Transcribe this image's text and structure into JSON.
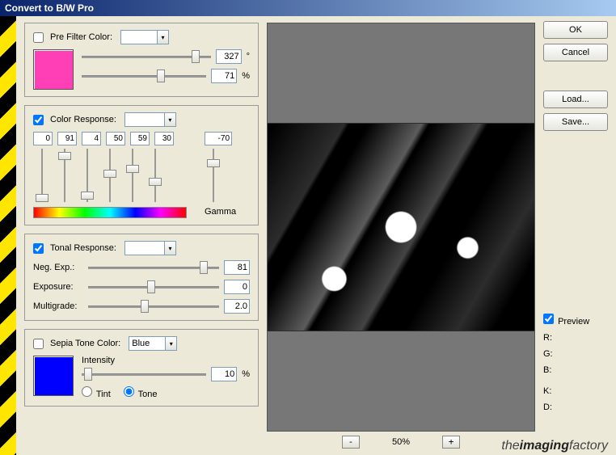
{
  "title": "Convert to B/W Pro",
  "preFilter": {
    "label": "Pre Filter Color:",
    "checked": false,
    "swatch": "#ff3fb5",
    "slider1Value": 327,
    "slider1Suffix": "°",
    "slider1Pos": 85,
    "slider2Value": 71,
    "slider2Suffix": "%",
    "slider2Pos": 60
  },
  "colorResponse": {
    "label": "Color Response:",
    "checked": true,
    "channels": [
      {
        "value": 0,
        "pos": 95
      },
      {
        "value": 91,
        "pos": 10
      },
      {
        "value": 4,
        "pos": 90
      },
      {
        "value": 50,
        "pos": 45
      },
      {
        "value": 59,
        "pos": 35
      },
      {
        "value": 30,
        "pos": 60
      }
    ],
    "gammaValue": -70,
    "gammaPos": 25,
    "gammaLabel": "Gamma"
  },
  "tonalResponse": {
    "label": "Tonal Response:",
    "checked": true,
    "rows": [
      {
        "label": "Neg. Exp.:",
        "value": 81,
        "pos": 85
      },
      {
        "label": "Exposure:",
        "value": 0,
        "pos": 45
      },
      {
        "label": "Multigrade:",
        "value": "2.0",
        "pos": 40
      }
    ]
  },
  "sepia": {
    "label": "Sepia Tone Color:",
    "checked": false,
    "dropdown": "Blue",
    "swatch": "#0000ff",
    "intensity": {
      "label": "Intensity",
      "value": 10,
      "suffix": "%",
      "pos": 2
    },
    "radios": {
      "tint": "Tint",
      "tone": "Tone",
      "selected": "tone"
    }
  },
  "zoom": {
    "minus": "-",
    "label": "50%",
    "plus": "+"
  },
  "buttons": {
    "ok": "OK",
    "cancel": "Cancel",
    "load": "Load...",
    "save": "Save..."
  },
  "preview": {
    "label": "Preview",
    "checked": true
  },
  "info": {
    "r": "R:",
    "g": "G:",
    "b": "B:",
    "k": "K:",
    "d": "D:"
  },
  "brand": {
    "pre": "the",
    "bold": "imaging",
    "post": "factory"
  }
}
